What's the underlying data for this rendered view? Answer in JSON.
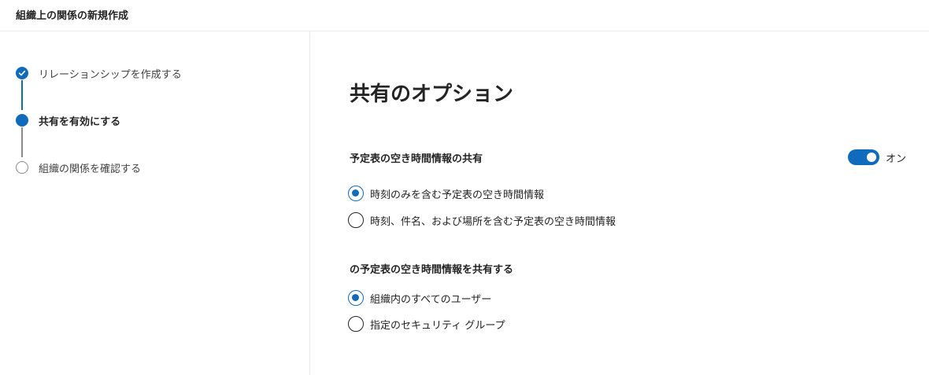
{
  "header": {
    "title": "組織上の関係の新規作成"
  },
  "steps": [
    {
      "label": "リレーションシップを作成する",
      "state": "completed",
      "icon": "checkmark-icon"
    },
    {
      "label": "共有を有効にする",
      "state": "current"
    },
    {
      "label": "組織の関係を確認する",
      "state": "pending"
    }
  ],
  "main": {
    "title": "共有のオプション",
    "calendar_sharing": {
      "title": "予定表の空き時間情報の共有",
      "toggle_label": "オン",
      "toggle_on": true,
      "options": [
        {
          "label": "時刻のみを含む予定表の空き時間情報",
          "selected": true
        },
        {
          "label": "時刻、件名、および場所を含む予定表の空き時間情報",
          "selected": false
        }
      ]
    },
    "share_with": {
      "title": "の予定表の空き時間情報を共有する",
      "options": [
        {
          "label": "組織内のすべてのユーザー",
          "selected": true
        },
        {
          "label": "指定のセキュリティ グループ",
          "selected": false
        }
      ]
    }
  },
  "colors": {
    "accent": "#0f6cbd",
    "pending": "#8a8a8a",
    "text": "#242424"
  }
}
